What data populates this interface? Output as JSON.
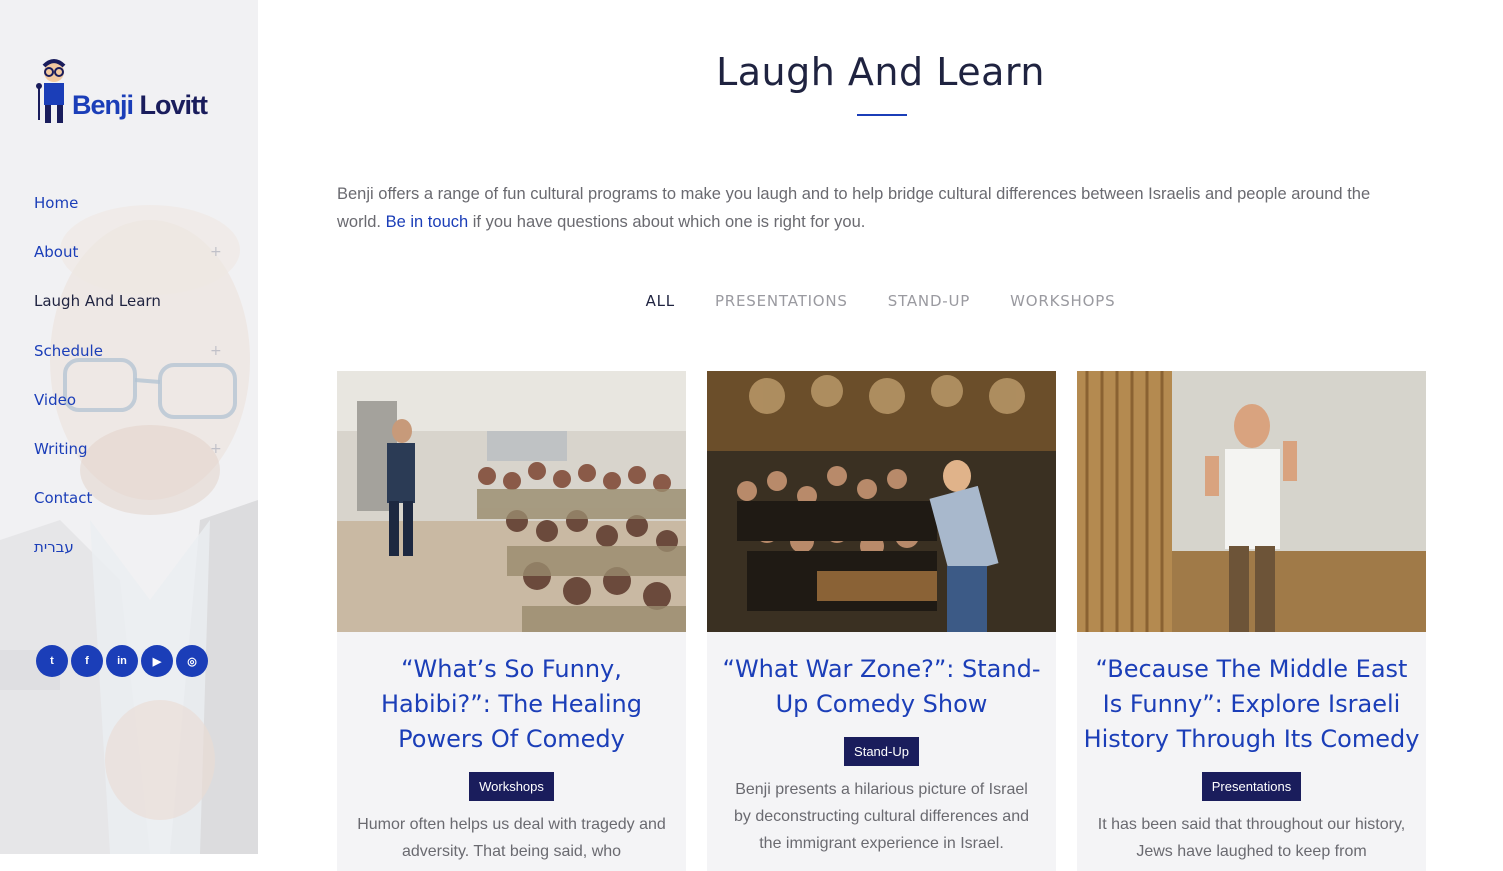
{
  "brand": {
    "first": "Benji",
    "last": "Lovitt"
  },
  "nav": [
    {
      "label": "Home",
      "has_sub": false,
      "active": false
    },
    {
      "label": "About",
      "has_sub": true,
      "active": false
    },
    {
      "label": "Laugh And Learn",
      "has_sub": false,
      "active": true
    },
    {
      "label": "Schedule",
      "has_sub": true,
      "active": false
    },
    {
      "label": "Video",
      "has_sub": false,
      "active": false
    },
    {
      "label": "Writing",
      "has_sub": true,
      "active": false
    },
    {
      "label": "Contact",
      "has_sub": false,
      "active": false
    },
    {
      "label": "עברית",
      "has_sub": false,
      "active": false
    }
  ],
  "social": [
    {
      "name": "twitter-icon",
      "glyph": "t"
    },
    {
      "name": "facebook-icon",
      "glyph": "f"
    },
    {
      "name": "linkedin-icon",
      "glyph": "in"
    },
    {
      "name": "youtube-icon",
      "glyph": "▶"
    },
    {
      "name": "instagram-icon",
      "glyph": "◎"
    }
  ],
  "page": {
    "title": "Laugh And Learn",
    "intro_before": "Benji offers a range of fun cultural programs to make you laugh and to help bridge cultural differences between Israelis and people around the world. ",
    "intro_link": "Be in touch",
    "intro_after": " if you have questions about which one is right for you."
  },
  "filters": [
    {
      "label": "ALL",
      "active": true
    },
    {
      "label": "PRESENTATIONS",
      "active": false
    },
    {
      "label": "STAND-UP",
      "active": false
    },
    {
      "label": "WORKSHOPS",
      "active": false
    }
  ],
  "cards": [
    {
      "title": "“What’s So Funny, Habibi?”: The Healing Powers Of Comedy",
      "tag": "Workshops",
      "desc": "Humor often helps us deal with tragedy and adversity. That being said, who"
    },
    {
      "title": "“What War Zone?”: Stand-Up Comedy Show",
      "tag": "Stand-Up",
      "desc": "Benji presents a hilarious picture of Israel by deconstructing cultural differences and the immigrant experience in Israel."
    },
    {
      "title": "“Because The Middle East Is Funny”: Explore Israeli History Through Its Comedy",
      "tag": "Presentations",
      "desc": "It has been said that throughout our history, Jews have laughed to keep from"
    }
  ],
  "colors": {
    "accent": "#1b3eb8",
    "dark": "#1a1d5c",
    "text": "#6a6a70"
  }
}
